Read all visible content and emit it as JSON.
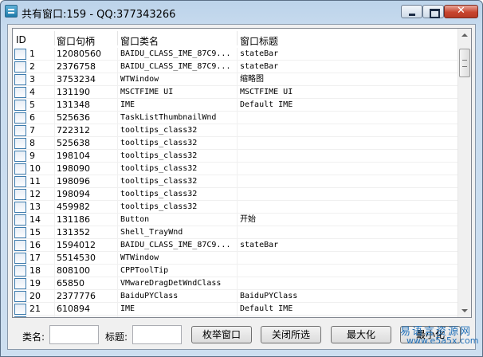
{
  "window": {
    "title": "共有窗口:159 - QQ:377343266",
    "close_glyph": "✕"
  },
  "list": {
    "headers": [
      "ID",
      "窗口句柄",
      "窗口类名",
      "窗口标题"
    ],
    "rows": [
      {
        "id": "1",
        "handle": "12080560",
        "class": "BAIDU_CLASS_IME_87C9...",
        "title": "stateBar"
      },
      {
        "id": "2",
        "handle": "2376758",
        "class": "BAIDU_CLASS_IME_87C9...",
        "title": "stateBar"
      },
      {
        "id": "3",
        "handle": "3753234",
        "class": "WTWindow",
        "title": "缩略图"
      },
      {
        "id": "4",
        "handle": "131190",
        "class": "MSCTFIME UI",
        "title": "MSCTFIME UI"
      },
      {
        "id": "5",
        "handle": "131348",
        "class": "IME",
        "title": "Default IME"
      },
      {
        "id": "6",
        "handle": "525636",
        "class": "TaskListThumbnailWnd",
        "title": ""
      },
      {
        "id": "7",
        "handle": "722312",
        "class": "tooltips_class32",
        "title": ""
      },
      {
        "id": "8",
        "handle": "525638",
        "class": "tooltips_class32",
        "title": ""
      },
      {
        "id": "9",
        "handle": "198104",
        "class": "tooltips_class32",
        "title": ""
      },
      {
        "id": "10",
        "handle": "198090",
        "class": "tooltips_class32",
        "title": ""
      },
      {
        "id": "11",
        "handle": "198096",
        "class": "tooltips_class32",
        "title": ""
      },
      {
        "id": "12",
        "handle": "198094",
        "class": "tooltips_class32",
        "title": ""
      },
      {
        "id": "13",
        "handle": "459982",
        "class": "tooltips_class32",
        "title": ""
      },
      {
        "id": "14",
        "handle": "131186",
        "class": "Button",
        "title": "开始"
      },
      {
        "id": "15",
        "handle": "131352",
        "class": "Shell_TrayWnd",
        "title": ""
      },
      {
        "id": "16",
        "handle": "1594012",
        "class": "BAIDU_CLASS_IME_87C9...",
        "title": "stateBar"
      },
      {
        "id": "17",
        "handle": "5514530",
        "class": "WTWindow",
        "title": ""
      },
      {
        "id": "18",
        "handle": "808100",
        "class": "CPPToolTip",
        "title": ""
      },
      {
        "id": "19",
        "handle": "65850",
        "class": "VMwareDragDetWndClass",
        "title": ""
      },
      {
        "id": "20",
        "handle": "2377776",
        "class": "BaiduPYClass",
        "title": "BaiduPYClass"
      },
      {
        "id": "21",
        "handle": "610894",
        "class": "IME",
        "title": "Default IME"
      }
    ]
  },
  "bottom": {
    "class_label": "类名:",
    "title_label": "标题:",
    "class_value": "",
    "title_value": "",
    "enum_button": "枚举窗口",
    "close_selected_button": "关闭所选",
    "maximize_button": "最大化",
    "minimize_button": "最小化"
  },
  "watermark": {
    "line1": "易语言资源网",
    "line2": "www.e5a5x.com"
  }
}
